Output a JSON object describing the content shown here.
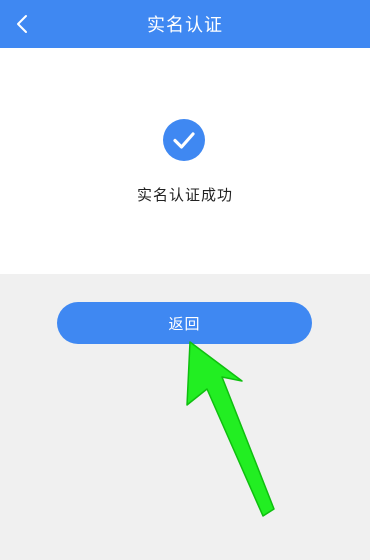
{
  "header": {
    "title": "实名认证",
    "back_icon": "chevron-left-icon"
  },
  "result": {
    "icon": "check-circle-icon",
    "message": "实名认证成功"
  },
  "actions": {
    "back_label": "返回"
  },
  "colors": {
    "primary": "#3f88f2",
    "arrow": "#22ee22",
    "panel": "#ffffff",
    "background": "#f0f0f0"
  }
}
